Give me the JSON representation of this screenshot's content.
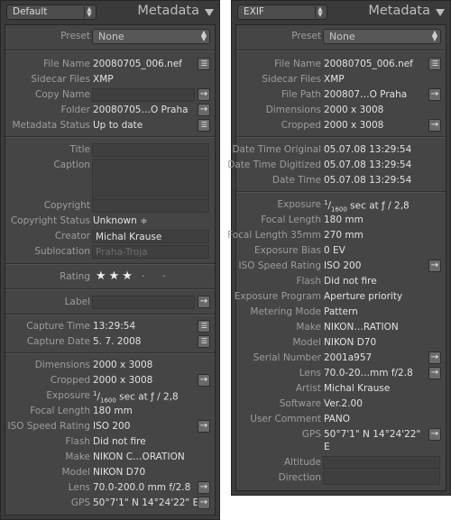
{
  "left": {
    "preset_select": "Default",
    "title": "Metadata",
    "preset": {
      "label": "Preset",
      "value": "None"
    },
    "file_name": {
      "label": "File Name",
      "value": "20080705_006.nef"
    },
    "sidecar": {
      "label": "Sidecar Files",
      "value": "XMP"
    },
    "copy_name": {
      "label": "Copy Name",
      "value": ""
    },
    "folder": {
      "label": "Folder",
      "value": "20080705…O Praha"
    },
    "metadata_status": {
      "label": "Metadata Status",
      "value": "Up to date"
    },
    "title_field": {
      "label": "Title",
      "value": ""
    },
    "caption": {
      "label": "Caption",
      "value": ""
    },
    "copyright": {
      "label": "Copyright",
      "value": ""
    },
    "copyright_status": {
      "label": "Copyright Status",
      "value": "Unknown"
    },
    "creator": {
      "label": "Creator",
      "value": "Michal Krause"
    },
    "sublocation": {
      "label": "Sublocation",
      "value": "Praha-Troja"
    },
    "rating": {
      "label": "Rating",
      "stars": "★★★",
      "empty": "· ·",
      "value": 3
    },
    "label": {
      "label": "Label",
      "value": ""
    },
    "capture_time": {
      "label": "Capture Time",
      "value": "13:29:54"
    },
    "capture_date": {
      "label": "Capture Date",
      "value": "5. 7. 2008"
    },
    "dimensions": {
      "label": "Dimensions",
      "value": "2000 x 3008"
    },
    "cropped": {
      "label": "Cropped",
      "value": "2000 x 3008"
    },
    "exposure": {
      "label": "Exposure",
      "num": "1",
      "den": "1600",
      "rest": " sec at ƒ / 2,8"
    },
    "focal_length": {
      "label": "Focal Length",
      "value": "180 mm"
    },
    "iso": {
      "label": "ISO Speed Rating",
      "value": "ISO 200"
    },
    "flash": {
      "label": "Flash",
      "value": "Did not fire"
    },
    "make": {
      "label": "Make",
      "value": "NIKON C…ORATION"
    },
    "model": {
      "label": "Model",
      "value": "NIKON D70"
    },
    "lens": {
      "label": "Lens",
      "value": "70.0-200.0 mm f/2.8"
    },
    "gps": {
      "label": "GPS",
      "value": "50°7'1\" N 14°24'22\" E"
    }
  },
  "right": {
    "preset_select": "EXIF",
    "title": "Metadata",
    "preset": {
      "label": "Preset",
      "value": "None"
    },
    "file_name": {
      "label": "File Name",
      "value": "20080705_006.nef"
    },
    "sidecar": {
      "label": "Sidecar Files",
      "value": "XMP"
    },
    "file_path": {
      "label": "File Path",
      "value": "200807…O Praha"
    },
    "dimensions": {
      "label": "Dimensions",
      "value": "2000 x 3008"
    },
    "cropped": {
      "label": "Cropped",
      "value": "2000 x 3008"
    },
    "dt_original": {
      "label": "Date Time Original",
      "value": "05.07.08 13:29:54"
    },
    "dt_digitized": {
      "label": "Date Time Digitized",
      "value": "05.07.08 13:29:54"
    },
    "date_time": {
      "label": "Date Time",
      "value": "05.07.08 13:29:54"
    },
    "exposure": {
      "label": "Exposure",
      "num": "1",
      "den": "1600",
      "rest": " sec at ƒ / 2,8"
    },
    "focal_length": {
      "label": "Focal Length",
      "value": "180 mm"
    },
    "focal_35": {
      "label": "Focal Length 35mm",
      "value": "270 mm"
    },
    "exposure_bias": {
      "label": "Exposure Bias",
      "value": "0 EV"
    },
    "iso": {
      "label": "ISO Speed Rating",
      "value": "ISO 200"
    },
    "flash": {
      "label": "Flash",
      "value": "Did not fire"
    },
    "program": {
      "label": "Exposure Program",
      "value": "Aperture priority"
    },
    "metering": {
      "label": "Metering Mode",
      "value": "Pattern"
    },
    "make": {
      "label": "Make",
      "value": "NIKON…RATION"
    },
    "model": {
      "label": "Model",
      "value": "NIKON D70"
    },
    "serial": {
      "label": "Serial Number",
      "value": "2001a957"
    },
    "lens": {
      "label": "Lens",
      "value": "70.0-20…mm f/2.8"
    },
    "artist": {
      "label": "Artist",
      "value": "Michal Krause"
    },
    "software": {
      "label": "Software",
      "value": "Ver.2.00"
    },
    "user_comment": {
      "label": "User Comment",
      "value": "PANO"
    },
    "gps": {
      "label": "GPS",
      "line1": "50°7'1\" N 14°24'22\"",
      "line2": "E"
    },
    "altitude": {
      "label": "Altitude",
      "value": ""
    },
    "direction": {
      "label": "Direction",
      "value": ""
    }
  }
}
